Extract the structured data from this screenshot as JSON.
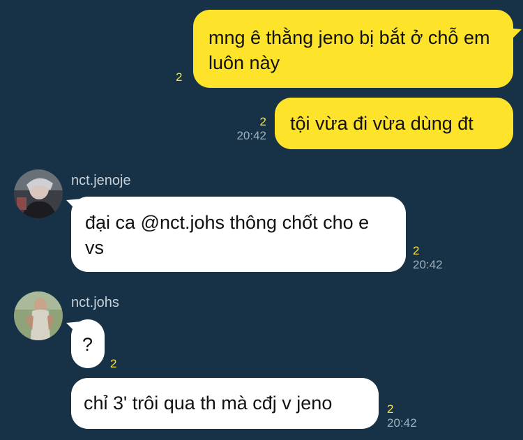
{
  "messages": [
    {
      "text": "mng ê thằng jeno bị bắt ở chỗ em luôn này",
      "unread": "2",
      "time": ""
    },
    {
      "text": "tội vừa đi vừa dùng đt",
      "unread": "2",
      "time": "20:42"
    },
    {
      "sender": "nct.jenoje",
      "text": "đại ca @nct.johs thông chốt cho e vs",
      "unread": "2",
      "time": "20:42"
    },
    {
      "sender": "nct.johs",
      "text": "?",
      "unread": "2",
      "time": ""
    },
    {
      "text": "chỉ 3' trôi qua th mà cđj v jeno",
      "unread": "2",
      "time": "20:42"
    }
  ],
  "colors": {
    "background": "#173246",
    "outgoing_bubble": "#fde32a",
    "incoming_bubble": "#ffffff",
    "unread_count": "#f7e33a",
    "timestamp": "#9fb0bd"
  },
  "icons": {
    "avatar_1": "user-avatar-photo",
    "avatar_2": "user-avatar-photo"
  }
}
